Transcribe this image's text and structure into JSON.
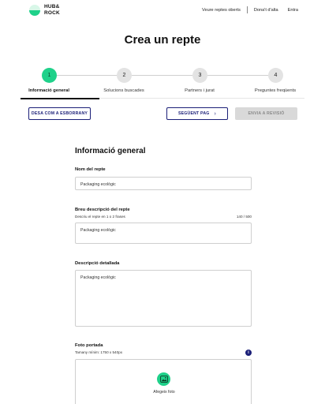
{
  "header": {
    "logo_line1": "HUB&",
    "logo_line2": "ROCK",
    "nav": {
      "open_challenges": "Veure reptes oberts",
      "signup": "Dona't d'alta",
      "login": "Entra"
    }
  },
  "page_title": "Crea un repte",
  "stepper": {
    "steps": [
      {
        "number": "1",
        "label": "Informació general",
        "active": true
      },
      {
        "number": "2",
        "label": "Solucions buscades",
        "active": false
      },
      {
        "number": "3",
        "label": "Partners i jurat",
        "active": false
      },
      {
        "number": "4",
        "label": "Preguntes freqüents",
        "active": false
      }
    ]
  },
  "actions": {
    "save_draft": "DESA COM A ESBORRANY",
    "next_page": "SEGÜENT PAG",
    "send_review": "ENVIA A REVISIÓ"
  },
  "form": {
    "section_title": "Informació general",
    "challenge_name": {
      "label": "Nom del repte",
      "value": "Packaging ecològic"
    },
    "short_description": {
      "label": "Breu descripció del repte",
      "help": "Descriu el repte en 1 o 2 frases",
      "counter": "140 / 500",
      "value": "Packaging ecològic"
    },
    "detailed_description": {
      "label": "Descripció detallada",
      "value": "Packaging ecològic"
    },
    "cover_photo": {
      "label": "Foto portada",
      "help": "Tamany mínim: 1750 x 540px",
      "info": "i",
      "add_label": "Afegeix foto"
    }
  },
  "colors": {
    "accent_green": "#1fd18a",
    "navy": "#1b1f78"
  }
}
